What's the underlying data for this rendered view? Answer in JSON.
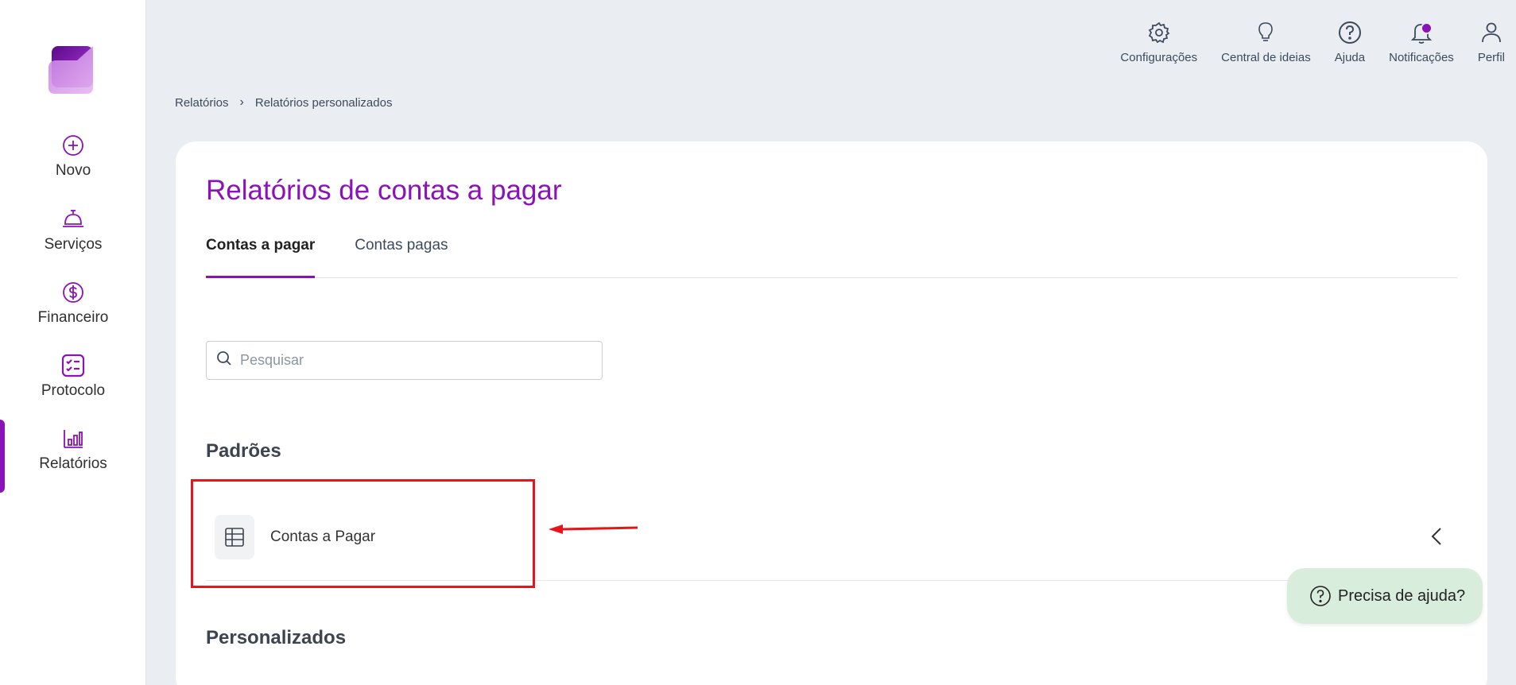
{
  "sidebar": {
    "items": [
      {
        "label": "Novo",
        "icon": "plus-circle-icon"
      },
      {
        "label": "Serviços",
        "icon": "service-bell-icon"
      },
      {
        "label": "Financeiro",
        "icon": "dollar-circle-icon"
      },
      {
        "label": "Protocolo",
        "icon": "checklist-icon"
      },
      {
        "label": "Relatórios",
        "icon": "bar-chart-icon",
        "active": true
      }
    ]
  },
  "topbar": {
    "items": [
      {
        "label": "Configurações",
        "icon": "gear-icon"
      },
      {
        "label": "Central de ideias",
        "icon": "lightbulb-icon"
      },
      {
        "label": "Ajuda",
        "icon": "question-circle-icon"
      },
      {
        "label": "Notificações",
        "icon": "bell-icon"
      },
      {
        "label": "Perfil",
        "icon": "user-icon"
      }
    ]
  },
  "breadcrumb": {
    "items": [
      "Relatórios",
      "Relatórios personalizados"
    ],
    "separator": "›"
  },
  "main": {
    "title": "Relatórios de contas a pagar",
    "tabs": [
      {
        "label": "Contas a pagar",
        "active": true
      },
      {
        "label": "Contas pagas",
        "active": false
      }
    ],
    "search": {
      "placeholder": "Pesquisar",
      "value": ""
    },
    "sections": {
      "default_title": "Padrões",
      "custom_title": "Personalizados"
    },
    "reports": [
      {
        "label": "Contas a Pagar",
        "icon": "table-icon"
      }
    ]
  },
  "help": {
    "label": "Precisa de ajuda?"
  },
  "colors": {
    "accent": "#8a12b8",
    "background": "#eaeef2",
    "annotation": "#e8141c",
    "help_bg": "#d8eddc"
  }
}
